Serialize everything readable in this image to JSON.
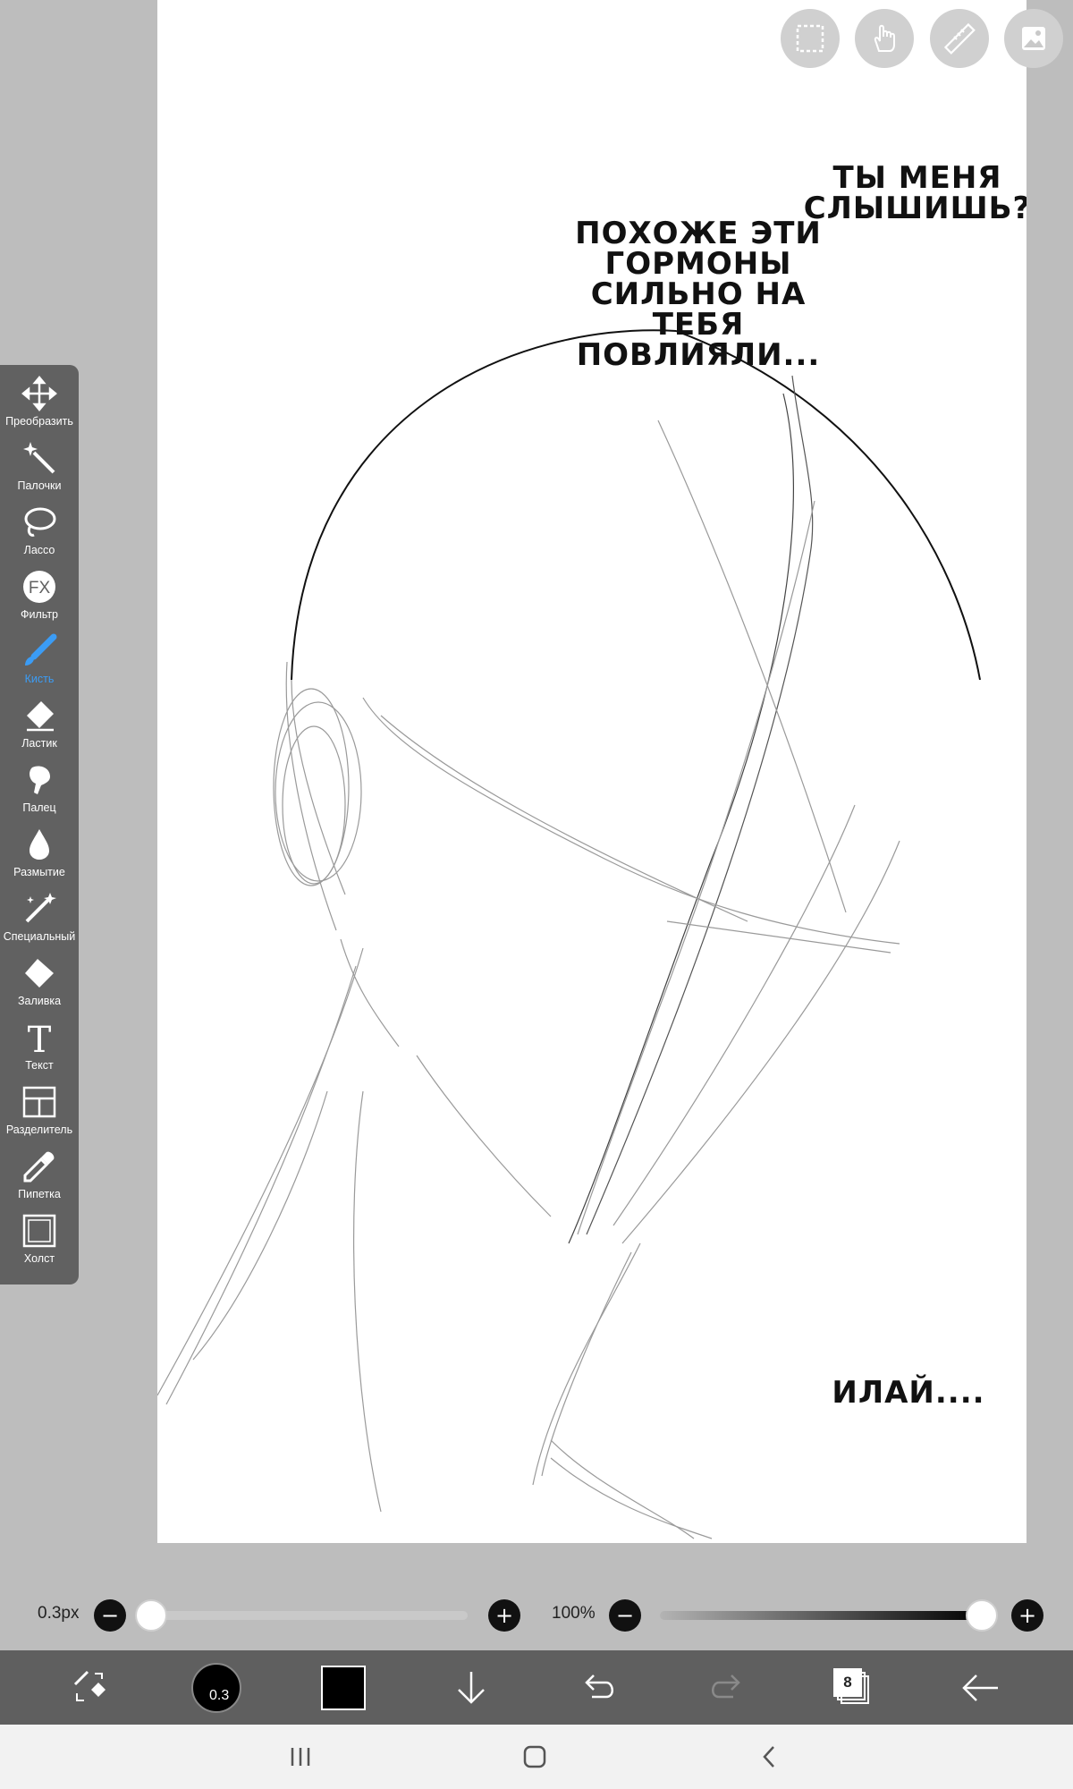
{
  "canvas": {
    "speech_bubbles": [
      "ТЫ МЕНЯ\nСЛЫШИШЬ?",
      "ПОХОЖЕ ЭТИ\nГОРМОНЫ\nСИЛЬНО НА\nТЕБЯ ПОВЛИЯЛИ...",
      "ИЛАЙ...."
    ]
  },
  "top_buttons": [
    {
      "name": "selection-icon"
    },
    {
      "name": "hand-icon"
    },
    {
      "name": "ruler-icon"
    },
    {
      "name": "material-icon"
    }
  ],
  "tools": [
    {
      "label": "Преобразить",
      "icon": "move-icon"
    },
    {
      "label": "Палочки",
      "icon": "magic-wand-icon"
    },
    {
      "label": "Лассо",
      "icon": "lasso-icon"
    },
    {
      "label": "Фильтр",
      "icon": "fx-icon"
    },
    {
      "label": "Кисть",
      "icon": "brush-icon",
      "active": true
    },
    {
      "label": "Ластик",
      "icon": "eraser-icon"
    },
    {
      "label": "Палец",
      "icon": "finger-icon"
    },
    {
      "label": "Размытие",
      "icon": "blur-drop-icon"
    },
    {
      "label": "Специальный",
      "icon": "special-pen-icon"
    },
    {
      "label": "Заливка",
      "icon": "fill-bucket-icon"
    },
    {
      "label": "Текст",
      "icon": "text-icon"
    },
    {
      "label": "Разделитель",
      "icon": "frame-divider-icon"
    },
    {
      "label": "Пипетка",
      "icon": "eyedropper-icon"
    },
    {
      "label": "Холст",
      "icon": "canvas-icon"
    }
  ],
  "sliders": {
    "brush_size": {
      "value_label": "0.3px",
      "value": 0.3
    },
    "opacity": {
      "value_label": "100%",
      "value": 100
    }
  },
  "bottom_bar": {
    "brush_preview_label": "0.3",
    "layers_count": "8",
    "color": "#000000"
  },
  "colors": {
    "accent": "#3b9cf5",
    "toolbox": "#616161",
    "bottom_bar": "#5f5f5f"
  }
}
